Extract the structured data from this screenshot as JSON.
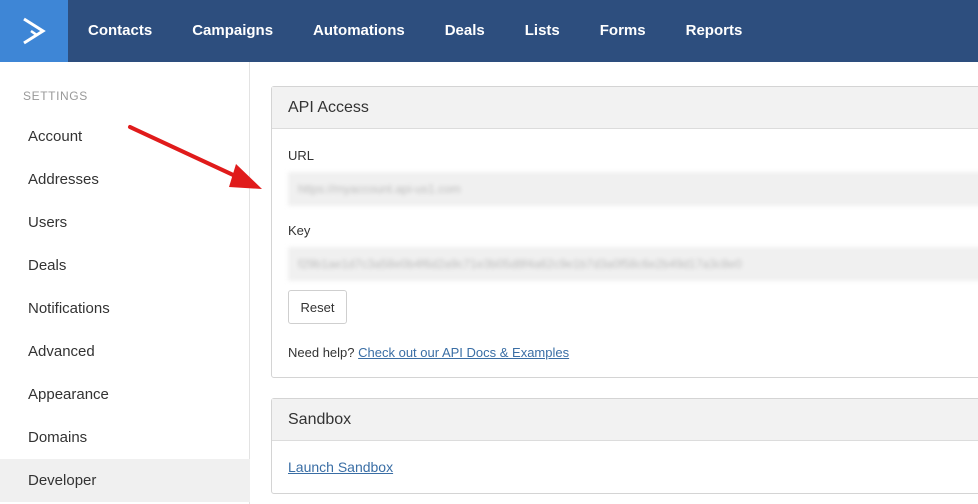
{
  "nav": {
    "items": [
      "Contacts",
      "Campaigns",
      "Automations",
      "Deals",
      "Lists",
      "Forms",
      "Reports"
    ]
  },
  "sidebar": {
    "title": "SETTINGS",
    "items": [
      "Account",
      "Addresses",
      "Users",
      "Deals",
      "Notifications",
      "Advanced",
      "Appearance",
      "Domains",
      "Developer"
    ],
    "active": "Developer"
  },
  "api_access": {
    "title": "API Access",
    "url_label": "URL",
    "url_value": "https://myaccount.api-us1.com",
    "key_label": "Key",
    "key_value": "f29b1ae1d7c3a58e0b4f6d2a9c71e3b05d8f4a62c9e1b7d3a0f58c6e2b49d17a3c8e0",
    "reset_label": "Reset",
    "help_text": "Need help?",
    "help_link": "Check out our API Docs & Examples"
  },
  "sandbox": {
    "title": "Sandbox",
    "link": "Launch Sandbox"
  },
  "colors": {
    "topbar": "#2d4e7e",
    "logo": "#3e86d6",
    "link": "#3a6ea5",
    "arrow": "#e01b1b"
  },
  "icons": {
    "logo": "activecampaign-chevron-icon",
    "annotation": "red-arrow"
  }
}
